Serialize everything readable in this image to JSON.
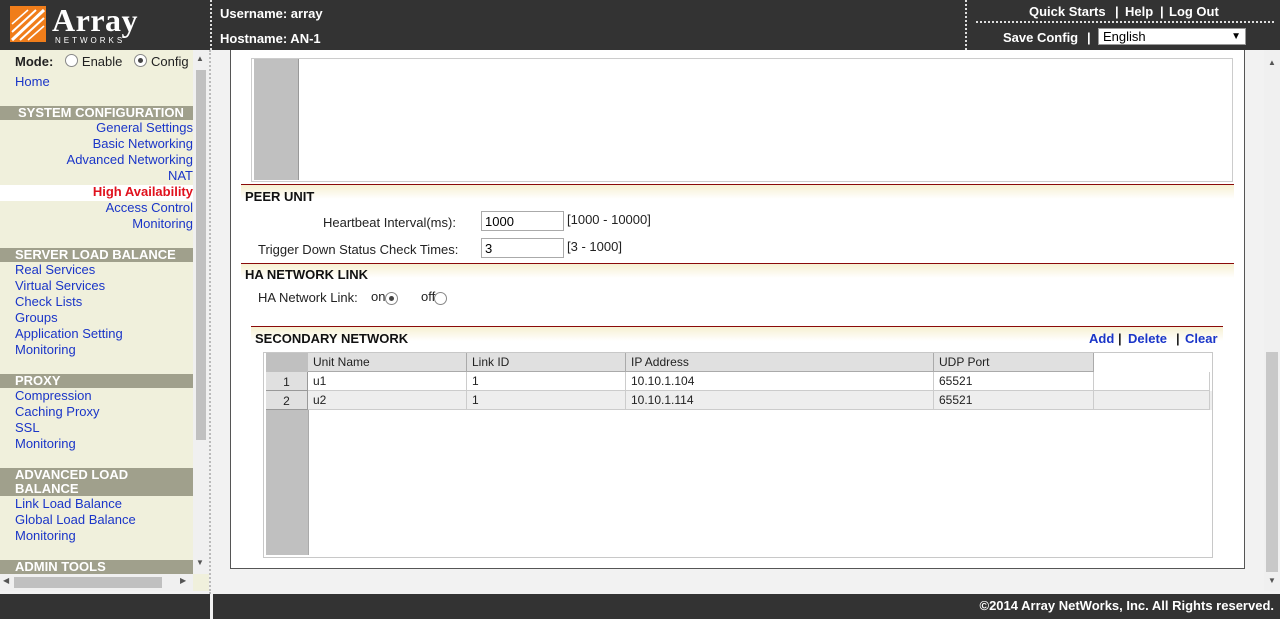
{
  "header": {
    "logo_text": "Array",
    "logo_sub": "NETWORKS",
    "username_label": "Username: array",
    "hostname_label": "Hostname: AN-1",
    "links": {
      "quick_starts": "Quick Starts",
      "help": "Help",
      "logout": "Log Out",
      "save_config": "Save Config"
    },
    "separator": "|",
    "language": {
      "selected": "English"
    }
  },
  "sidebar": {
    "mode_label": "Mode:",
    "mode_options": [
      "Enable",
      "Config"
    ],
    "mode_selected": "Config",
    "home": "Home",
    "sections": [
      {
        "title": "SYSTEM CONFIGURATION",
        "items": [
          "General Settings",
          "Basic Networking",
          "Advanced Networking",
          "NAT",
          "High Availability",
          "Access Control",
          "Monitoring"
        ]
      },
      {
        "title": "SERVER LOAD BALANCE",
        "items": [
          "Real Services",
          "Virtual Services",
          "Check Lists",
          "Groups",
          "Application Setting",
          "Monitoring"
        ]
      },
      {
        "title": "PROXY",
        "items": [
          "Compression",
          "Caching Proxy",
          "SSL",
          "Monitoring"
        ]
      },
      {
        "title": "ADVANCED LOAD BALANCE",
        "title_lines": [
          "ADVANCED LOAD",
          "BALANCE"
        ],
        "items": [
          "Link Load Balance",
          "Global Load Balance",
          "Monitoring"
        ]
      },
      {
        "title": "ADMIN TOOLS",
        "items": []
      }
    ],
    "active_item": "High Availability"
  },
  "main": {
    "peer_unit": {
      "title": "PEER UNIT",
      "heartbeat": {
        "label": "Heartbeat Interval(ms):",
        "value": "1000",
        "range": "[1000 - 10000]"
      },
      "trigger": {
        "label": "Trigger Down Status Check Times:",
        "value": "3",
        "range": "[3 - 1000]"
      }
    },
    "ha_link": {
      "title": "HA NETWORK LINK",
      "label": "HA Network Link:",
      "options": [
        "on",
        "off"
      ],
      "selected": "on"
    },
    "secondary": {
      "title": "SECONDARY NETWORK",
      "actions": [
        "Add",
        "Delete",
        "Clear"
      ],
      "columns": [
        "Unit Name",
        "Link ID",
        "IP Address",
        "UDP Port"
      ],
      "rows": [
        {
          "num": "1",
          "cells": [
            "u1",
            "1",
            "10.10.1.104",
            "65521"
          ]
        },
        {
          "num": "2",
          "cells": [
            "u2",
            "1",
            "10.10.1.114",
            "65521"
          ]
        }
      ]
    }
  },
  "footer": {
    "copyright": "©2014 Array NetWorks, Inc. All Rights reserved."
  },
  "colors": {
    "header_bg": "#333333",
    "sidebar_bg": "#f0f0dc",
    "section_head": "#a0a08c",
    "link": "#1a35c8",
    "active_link": "#e0111d",
    "logo_orange": "#f07d1a"
  }
}
